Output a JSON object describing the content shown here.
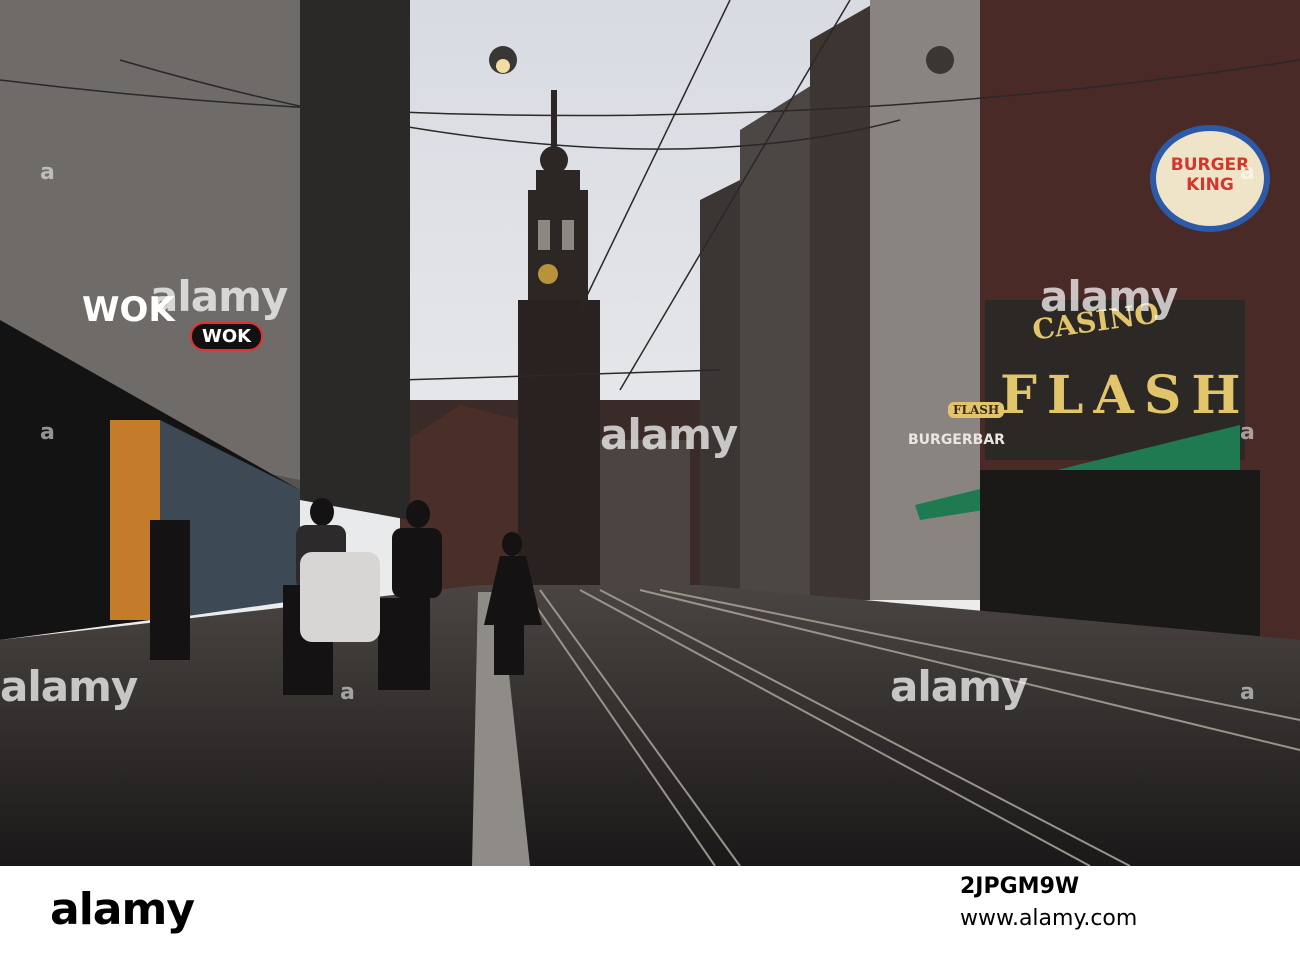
{
  "scene": {
    "description_colors": {
      "sky": "#e6e8ec",
      "silhouette": "#1c1a1a",
      "street": "#2a2726",
      "awning": "#1f7a52",
      "sign_yellow": "#e2c56b"
    }
  },
  "signs": {
    "wok_logo": "WOK",
    "wok_badge": "WOK",
    "casino": "CASINO",
    "flash": "FLASH",
    "flash_small": "FLASH",
    "burger_king_line1": "BURGER",
    "burger_king_line2": "KING",
    "burgerbar": "BURGERBAR"
  },
  "watermarks": {
    "center": "alamy",
    "top_left": "alamy",
    "top_right": "alamy",
    "mid_left": "alamy",
    "mid_center": "alamy",
    "bottom_left": "alamy",
    "bottom_right": "alamy",
    "bottom_center": "alamy"
  },
  "footer": {
    "logo": "alamy",
    "image_id": "2JPGM9W",
    "url": "www.alamy.com"
  }
}
